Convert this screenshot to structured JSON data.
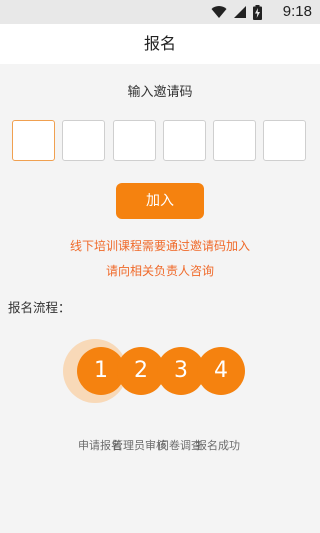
{
  "status_bar": {
    "time": "9:18",
    "icons": [
      "wifi-icon",
      "signal-icon",
      "battery-charging-icon"
    ]
  },
  "header": {
    "title": "报名"
  },
  "invite": {
    "heading": "输入邀请码",
    "box_count": 6,
    "join_label": "加入",
    "note_line1": "线下培训课程需要通过邀请码加入",
    "note_line2": "请向相关负责人咨询"
  },
  "flow": {
    "label": "报名流程：",
    "steps": [
      {
        "number": "1",
        "name": "申请报名"
      },
      {
        "number": "2",
        "name": "管理员审核"
      },
      {
        "number": "3",
        "name": "问卷调查"
      },
      {
        "number": "4",
        "name": "报名成功"
      }
    ]
  },
  "colors": {
    "accent": "#f5820f",
    "note": "#f06a2a",
    "halo": "#f8d9b8"
  }
}
